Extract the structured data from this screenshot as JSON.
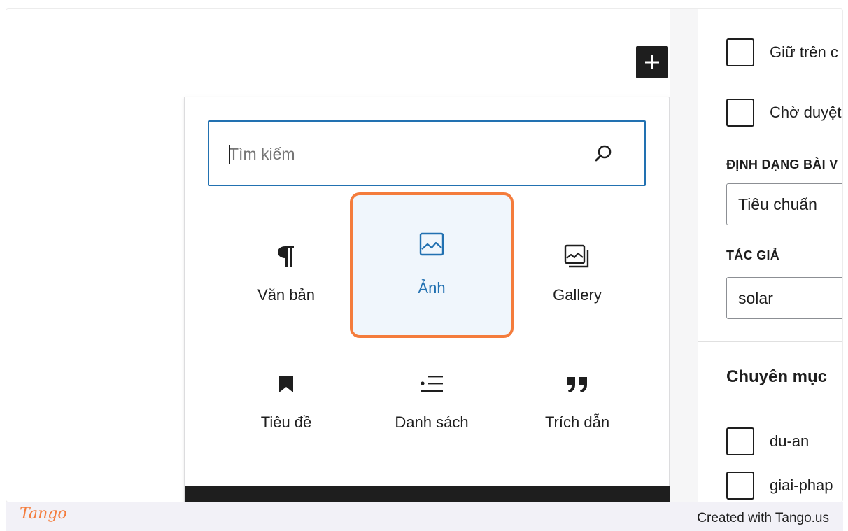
{
  "editor": {
    "add_block_icon": "plus-icon"
  },
  "inserter": {
    "search_placeholder": "Tìm kiếm",
    "search_icon": "search-icon",
    "blocks": [
      {
        "label": "Văn bản",
        "icon": "paragraph-icon",
        "selected": false
      },
      {
        "label": "Ảnh",
        "icon": "image-icon",
        "selected": true
      },
      {
        "label": "Gallery",
        "icon": "gallery-icon",
        "selected": false
      },
      {
        "label": "Tiêu đề",
        "icon": "heading-bookmark-icon",
        "selected": false
      },
      {
        "label": "Danh sách",
        "icon": "list-icon",
        "selected": false
      },
      {
        "label": "Trích dẫn",
        "icon": "quote-icon",
        "selected": false
      }
    ]
  },
  "sidebar": {
    "sticky_label": "Giữ trên c",
    "pending_label": "Chờ duyệt",
    "format_heading": "ĐỊNH DẠNG BÀI V",
    "format_value": "Tiêu chuẩn",
    "author_heading": "TÁC GIẢ",
    "author_value": "solar",
    "categories_title": "Chuyên mục",
    "categories": [
      {
        "label": "du-an"
      },
      {
        "label": "giai-phap"
      }
    ]
  },
  "footer": {
    "logo_text": "Tango",
    "created_text": "Created with Tango.us"
  },
  "colors": {
    "accent": "#2271b1",
    "highlight": "#f47c3c",
    "dark": "#1e1e1e"
  }
}
